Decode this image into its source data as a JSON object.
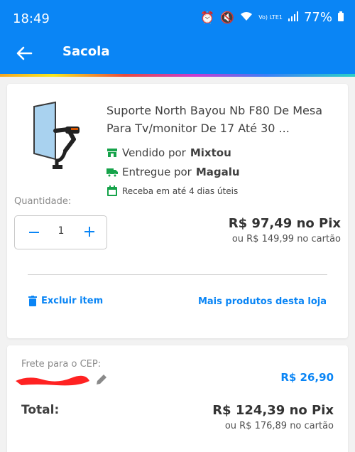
{
  "status_bar": {
    "time": "18:49",
    "battery": "77%",
    "network_label": "Vo) LTE1"
  },
  "header": {
    "title": "Sacola"
  },
  "cart_item": {
    "name": "Suporte North Bayou Nb F80 De Mesa Para Tv/monitor De 17 Até 30 ...",
    "sold_by_prefix": "Vendido por",
    "sold_by": "Mixtou",
    "delivered_by_prefix": "Entregue por",
    "delivered_by": "Magalu",
    "delivery_time": "Receba em até 4 dias úteis",
    "quantity_label": "Quantidade:",
    "quantity": "1",
    "price_pix": "R$ 97,49 no Pix",
    "price_card": "ou R$ 149,99 no cartão",
    "delete_label": "Excluir item",
    "more_products_label": "Mais produtos desta loja"
  },
  "summary": {
    "shipping_label": "Frete para o CEP:",
    "shipping_price": "R$ 26,90",
    "total_label": "Total:",
    "total_pix": "R$ 124,39 no Pix",
    "total_card": "ou R$ 176,89 no cartão"
  },
  "colors": {
    "primary": "#0a85f5",
    "success": "#16a34a",
    "redaction": "#ff2222"
  }
}
